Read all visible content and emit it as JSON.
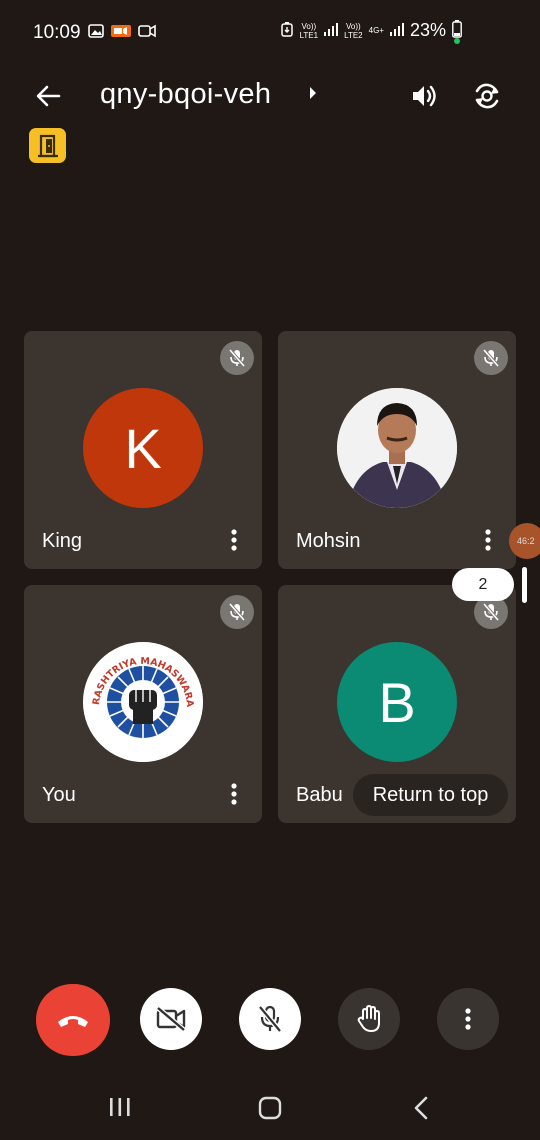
{
  "status_bar": {
    "time": "10:09",
    "sim1_label": "Vo))\nLTE1",
    "sim2_label": "Vo))\nLTE2",
    "network_type": "4G+",
    "battery_percent": "23%"
  },
  "header": {
    "meeting_code": "qny-bqoi-veh"
  },
  "tiles": [
    {
      "name": "King",
      "avatar_letter": "K",
      "avatar_color": "#c0370c"
    },
    {
      "name": "Mohsin",
      "avatar_letter": "",
      "avatar_color": "#ffffff"
    },
    {
      "name": "You",
      "avatar_letter": "",
      "avatar_color": "#ffffff"
    },
    {
      "name": "Babu",
      "avatar_letter": "B",
      "avatar_color": "#0b8a74"
    }
  ],
  "logo_text": "RASHTRIYA MAHASWARAJ BHUMI PARTY",
  "overlay": {
    "side_timer": "46:2",
    "page_indicator": "2",
    "return_to_top": "Return to top"
  },
  "colors": {
    "background": "#1f1814",
    "tile": "#3c342f",
    "end_call": "#ea4335",
    "door_badge": "#f6bf26"
  }
}
